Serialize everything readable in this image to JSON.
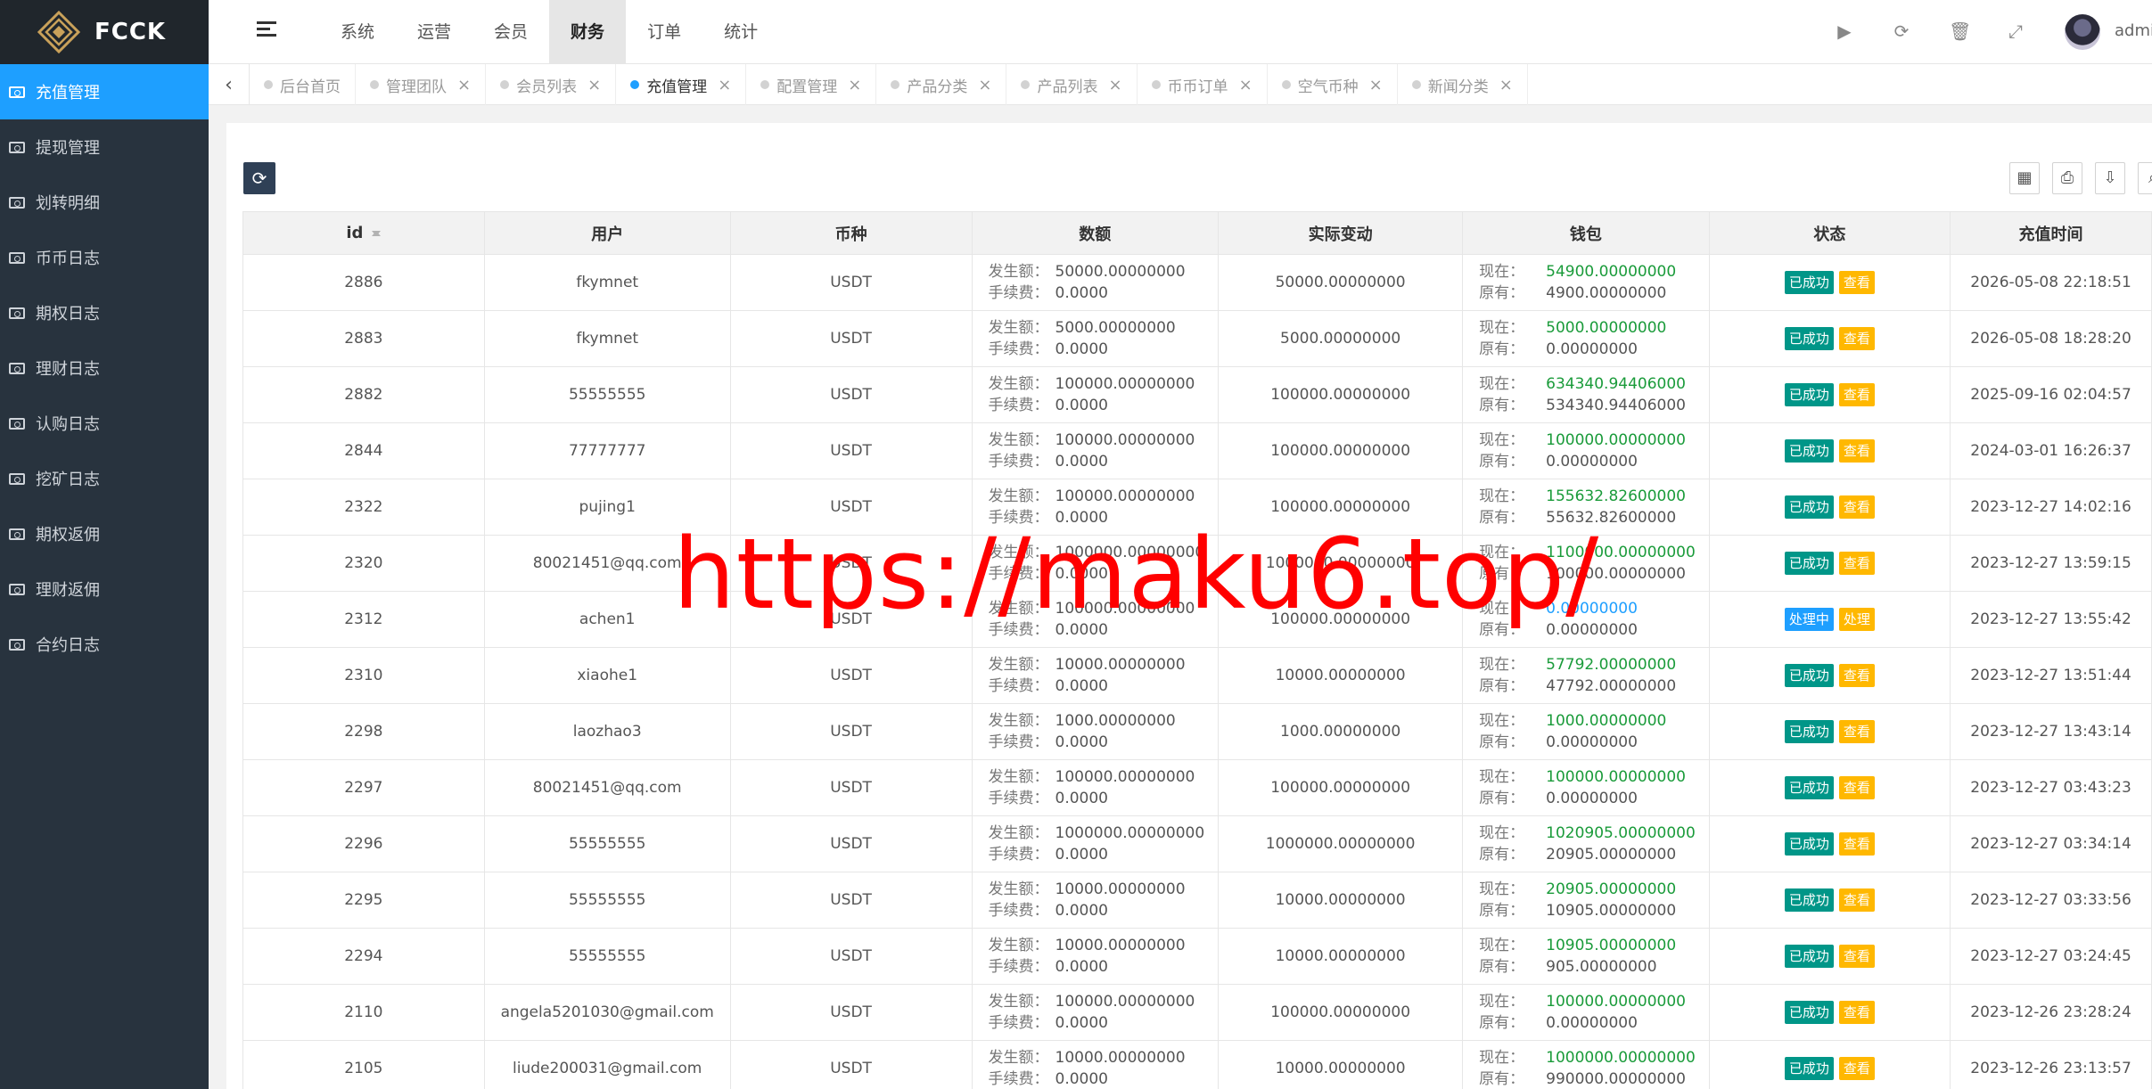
{
  "brand": {
    "name": "FCCK"
  },
  "sidebar": {
    "items": [
      {
        "label": "充值管理",
        "active": true
      },
      {
        "label": "提现管理",
        "active": false
      },
      {
        "label": "划转明细",
        "active": false
      },
      {
        "label": "币币日志",
        "active": false
      },
      {
        "label": "期权日志",
        "active": false
      },
      {
        "label": "理财日志",
        "active": false
      },
      {
        "label": "认购日志",
        "active": false
      },
      {
        "label": "挖矿日志",
        "active": false
      },
      {
        "label": "期权返佣",
        "active": false
      },
      {
        "label": "理财返佣",
        "active": false
      },
      {
        "label": "合约日志",
        "active": false
      }
    ]
  },
  "topnav": {
    "items": [
      {
        "label": "系统",
        "active": false
      },
      {
        "label": "运营",
        "active": false
      },
      {
        "label": "会员",
        "active": false
      },
      {
        "label": "财务",
        "active": true
      },
      {
        "label": "订单",
        "active": false
      },
      {
        "label": "统计",
        "active": false
      }
    ]
  },
  "header": {
    "username": "admin"
  },
  "tabs": [
    {
      "label": "后台首页",
      "active": false,
      "closable": false
    },
    {
      "label": "管理团队",
      "active": false,
      "closable": true
    },
    {
      "label": "会员列表",
      "active": false,
      "closable": true
    },
    {
      "label": "充值管理",
      "active": true,
      "closable": true
    },
    {
      "label": "配置管理",
      "active": false,
      "closable": true
    },
    {
      "label": "产品分类",
      "active": false,
      "closable": true
    },
    {
      "label": "产品列表",
      "active": false,
      "closable": true
    },
    {
      "label": "币币订单",
      "active": false,
      "closable": true
    },
    {
      "label": "空气币种",
      "active": false,
      "closable": true
    },
    {
      "label": "新闻分类",
      "active": false,
      "closable": true
    }
  ],
  "table": {
    "headers": {
      "id": "id",
      "user": "用户",
      "coin": "币种",
      "amount": "数额",
      "actual": "实际变动",
      "wallet": "钱包",
      "status": "状态",
      "time": "充值时间"
    },
    "labels": {
      "occur": "发生额：",
      "fee": "手续费：",
      "now": "现在：",
      "before": "原有："
    },
    "rows": [
      {
        "id": "2886",
        "user": "fkymnet",
        "coin": "USDT",
        "occur": "50000.00000000",
        "fee": "0.0000",
        "actual": "50000.00000000",
        "now": "54900.00000000",
        "before": "4900.00000000",
        "status": "已成功",
        "action": "查看",
        "time": "2026-05-08 22:18:51"
      },
      {
        "id": "2883",
        "user": "fkymnet",
        "coin": "USDT",
        "occur": "5000.00000000",
        "fee": "0.0000",
        "actual": "5000.00000000",
        "now": "5000.00000000",
        "before": "0.00000000",
        "status": "已成功",
        "action": "查看",
        "time": "2026-05-08 18:28:20"
      },
      {
        "id": "2882",
        "user": "55555555",
        "coin": "USDT",
        "occur": "100000.00000000",
        "fee": "0.0000",
        "actual": "100000.00000000",
        "now": "634340.94406000",
        "before": "534340.94406000",
        "status": "已成功",
        "action": "查看",
        "time": "2025-09-16 02:04:57"
      },
      {
        "id": "2844",
        "user": "77777777",
        "coin": "USDT",
        "occur": "100000.00000000",
        "fee": "0.0000",
        "actual": "100000.00000000",
        "now": "100000.00000000",
        "before": "0.00000000",
        "status": "已成功",
        "action": "查看",
        "time": "2024-03-01 16:26:37"
      },
      {
        "id": "2322",
        "user": "pujing1",
        "coin": "USDT",
        "occur": "100000.00000000",
        "fee": "0.0000",
        "actual": "100000.00000000",
        "now": "155632.82600000",
        "before": "55632.82600000",
        "status": "已成功",
        "action": "查看",
        "time": "2023-12-27 14:02:16"
      },
      {
        "id": "2320",
        "user": "80021451@qq.com",
        "coin": "USDT",
        "occur": "1000000.00000000",
        "fee": "0.0000",
        "actual": "1000000.00000000",
        "now": "1100000.00000000",
        "before": "100000.00000000",
        "status": "已成功",
        "action": "查看",
        "time": "2023-12-27 13:59:15"
      },
      {
        "id": "2312",
        "user": "achen1",
        "coin": "USDT",
        "occur": "100000.00000000",
        "fee": "0.0000",
        "actual": "100000.00000000",
        "now": "0.00000000",
        "before": "0.00000000",
        "status": "处理中",
        "action": "处理",
        "time": "2023-12-27 13:55:42",
        "pending": true
      },
      {
        "id": "2310",
        "user": "xiaohe1",
        "coin": "USDT",
        "occur": "10000.00000000",
        "fee": "0.0000",
        "actual": "10000.00000000",
        "now": "57792.00000000",
        "before": "47792.00000000",
        "status": "已成功",
        "action": "查看",
        "time": "2023-12-27 13:51:44"
      },
      {
        "id": "2298",
        "user": "laozhao3",
        "coin": "USDT",
        "occur": "1000.00000000",
        "fee": "0.0000",
        "actual": "1000.00000000",
        "now": "1000.00000000",
        "before": "0.00000000",
        "status": "已成功",
        "action": "查看",
        "time": "2023-12-27 13:43:14"
      },
      {
        "id": "2297",
        "user": "80021451@qq.com",
        "coin": "USDT",
        "occur": "100000.00000000",
        "fee": "0.0000",
        "actual": "100000.00000000",
        "now": "100000.00000000",
        "before": "0.00000000",
        "status": "已成功",
        "action": "查看",
        "time": "2023-12-27 03:43:23"
      },
      {
        "id": "2296",
        "user": "55555555",
        "coin": "USDT",
        "occur": "1000000.00000000",
        "fee": "0.0000",
        "actual": "1000000.00000000",
        "now": "1020905.00000000",
        "before": "20905.00000000",
        "status": "已成功",
        "action": "查看",
        "time": "2023-12-27 03:34:14"
      },
      {
        "id": "2295",
        "user": "55555555",
        "coin": "USDT",
        "occur": "10000.00000000",
        "fee": "0.0000",
        "actual": "10000.00000000",
        "now": "20905.00000000",
        "before": "10905.00000000",
        "status": "已成功",
        "action": "查看",
        "time": "2023-12-27 03:33:56"
      },
      {
        "id": "2294",
        "user": "55555555",
        "coin": "USDT",
        "occur": "10000.00000000",
        "fee": "0.0000",
        "actual": "10000.00000000",
        "now": "10905.00000000",
        "before": "905.00000000",
        "status": "已成功",
        "action": "查看",
        "time": "2023-12-27 03:24:45"
      },
      {
        "id": "2110",
        "user": "angela5201030@gmail.com",
        "coin": "USDT",
        "occur": "100000.00000000",
        "fee": "0.0000",
        "actual": "100000.00000000",
        "now": "100000.00000000",
        "before": "0.00000000",
        "status": "已成功",
        "action": "查看",
        "time": "2023-12-26 23:28:24"
      },
      {
        "id": "2105",
        "user": "liude200031@gmail.com",
        "coin": "USDT",
        "occur": "10000.00000000",
        "fee": "0.0000",
        "actual": "10000.00000000",
        "now": "1000000.00000000",
        "before": "990000.00000000",
        "status": "已成功",
        "action": "查看",
        "time": "2023-12-26 23:13:57"
      }
    ]
  },
  "watermark": {
    "text": "https://maku6.top/"
  },
  "colors": {
    "sidebar_bg": "#28333e",
    "active_blue": "#1e9fff",
    "success_green": "#009688",
    "action_orange": "#ffb800"
  }
}
